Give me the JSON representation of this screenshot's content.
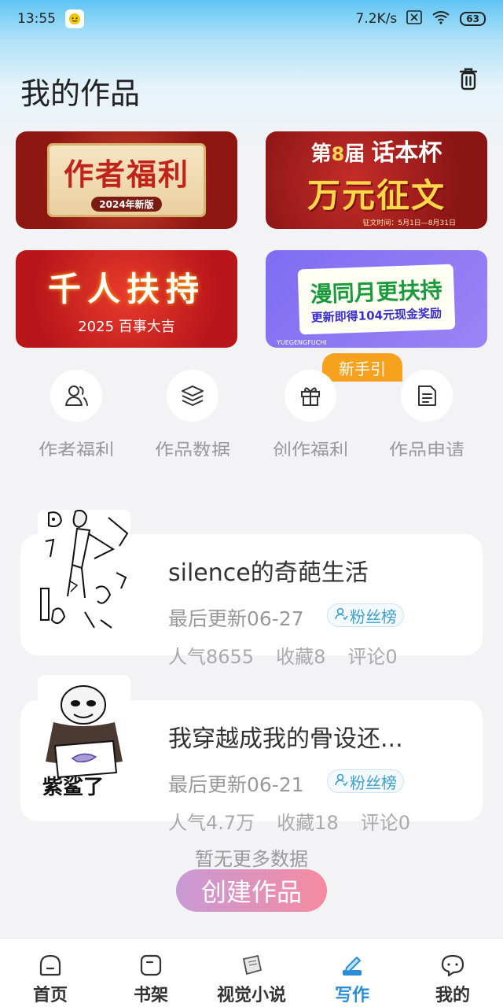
{
  "status_bar": {
    "time": "13:55",
    "network_speed": "7.2K/s",
    "battery": "63"
  },
  "page": {
    "title": "我的作品"
  },
  "banners": [
    {
      "main": "作者福利",
      "sub": "2024年新版"
    },
    {
      "edition_prefix": "第",
      "edition_num": "8",
      "edition_suffix": "届",
      "name": "话本杯",
      "main": "万元征文",
      "note": "征文时间：5月1日—8月31日"
    },
    {
      "main": "千人扶持",
      "sub": "2025 百事大吉"
    },
    {
      "main": "漫同月更扶持",
      "sub": "更新即得104元现金奖励",
      "foot": "YUEGENGFUCHI"
    }
  ],
  "new_guide_badge": "新手引",
  "quick_actions": [
    {
      "label": "作者福利",
      "icon": "users-icon"
    },
    {
      "label": "作品数据",
      "icon": "layers-icon"
    },
    {
      "label": "创作福利",
      "icon": "gift-icon"
    },
    {
      "label": "作品申请",
      "icon": "document-icon"
    }
  ],
  "works": [
    {
      "title": "silence的奇葩生活",
      "updated": "最后更新06-27",
      "fans_label": "粉丝榜",
      "popularity": "人气8655",
      "favorites": "收藏8",
      "comments": "评论0"
    },
    {
      "title": "我穿越成我的骨设还...",
      "updated": "最后更新06-21",
      "fans_label": "粉丝榜",
      "popularity": "人气4.7万",
      "favorites": "收藏18",
      "comments": "评论0",
      "cover_text": "紫鲨了"
    }
  ],
  "no_more": "暂无更多数据",
  "create_button": "创建作品",
  "tabs": [
    {
      "label": "首页",
      "icon": "home-icon"
    },
    {
      "label": "书架",
      "icon": "bookshelf-icon"
    },
    {
      "label": "视觉小说",
      "icon": "book-icon"
    },
    {
      "label": "写作",
      "icon": "pen-icon",
      "active": true
    },
    {
      "label": "我的",
      "icon": "chat-icon"
    }
  ],
  "colors": {
    "accent": "#2a8ed6",
    "create_start": "#c89bd6",
    "create_end": "#f58aa0",
    "badge": "#f7a21f"
  }
}
